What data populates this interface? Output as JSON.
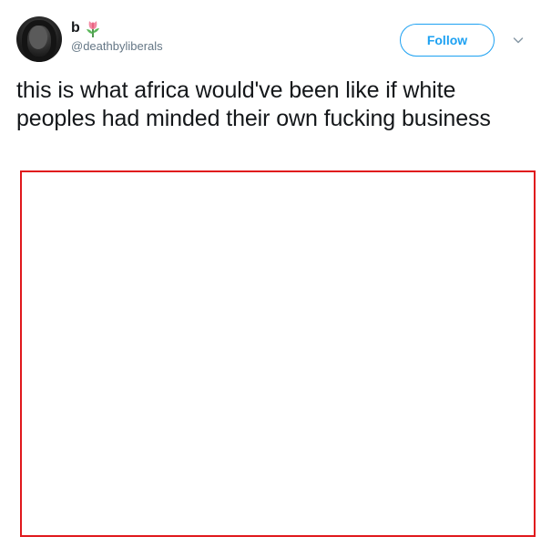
{
  "user": {
    "display_name": "b",
    "handle": "@deathbyliberals",
    "badge_icon": "tulip-icon",
    "avatar_icon": "profile-photo"
  },
  "actions": {
    "follow_label": "Follow",
    "menu_icon": "chevron-down-icon"
  },
  "tweet": {
    "text": "this is what africa would've been like if white peoples had minded their own fucking business"
  },
  "media": {
    "border_color": "#e0181c"
  },
  "colors": {
    "accent": "#1da1f2",
    "text": "#14171a",
    "secondary_text": "#657786"
  }
}
